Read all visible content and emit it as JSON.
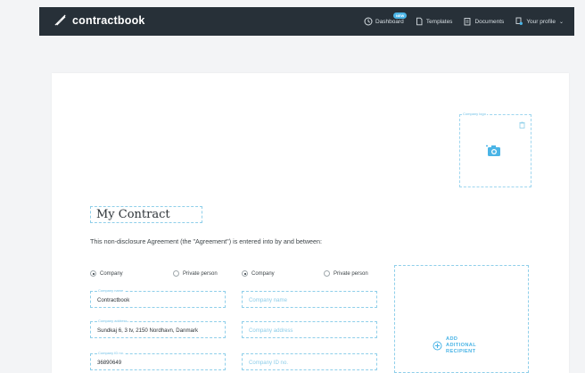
{
  "topbar": {
    "brand": "contractbook",
    "nav": [
      {
        "label": "Dashboard",
        "badge": "NEW",
        "icon": "clock-icon"
      },
      {
        "label": "Templates",
        "icon": "document-icon"
      },
      {
        "label": "Documents",
        "icon": "documents-icon"
      },
      {
        "label": "Your profile",
        "icon": "user-icon"
      }
    ]
  },
  "document": {
    "logo_box": {
      "label": "Company logo",
      "icon": "camera-icon",
      "delete_icon": "trash-icon"
    },
    "title": "My Contract",
    "intro": "This non-disclosure Agreement (the \"Agreement\") is entered into by and between:",
    "party1": {
      "radio_company": "Company",
      "radio_private": "Private person",
      "selected": "Company",
      "fields": [
        {
          "label": "Company name",
          "value": "Contractbook"
        },
        {
          "label": "Company address",
          "value": "Sundkaj 6, 3 tv, 2150 Nordhavn, Danmark"
        },
        {
          "label": "Company ID no.",
          "value": "36890649"
        }
      ]
    },
    "party2": {
      "radio_company": "Company",
      "radio_private": "Private person",
      "selected": "Company",
      "fields": [
        {
          "placeholder": "Company name"
        },
        {
          "placeholder": "Company address"
        },
        {
          "placeholder": "Company ID no."
        }
      ]
    },
    "add_recipient": [
      "ADD",
      "ADITIONAL",
      "RECIPIENT"
    ]
  },
  "colors": {
    "topbar": "#273038",
    "accent": "#4ab4e6",
    "dashed_border": "#8fcfea",
    "background": "#f3f4f6"
  }
}
